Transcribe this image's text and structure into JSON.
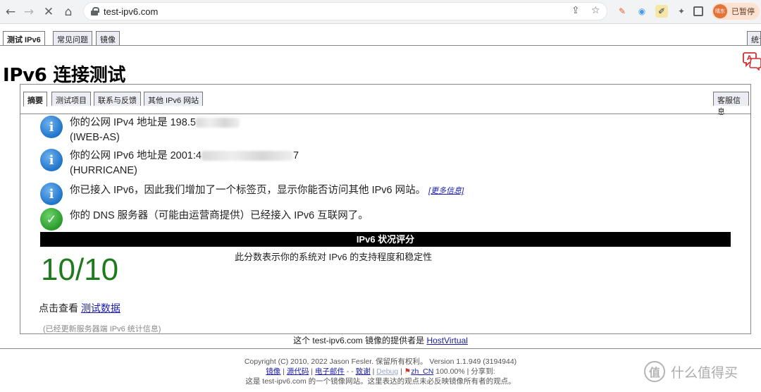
{
  "browser": {
    "url": "test-ipv6.com",
    "profile_label": "已暂停",
    "avatar_text": "晴东"
  },
  "top_tabs": [
    {
      "label": "测试 IPv6",
      "active": true
    },
    {
      "label": "常见问题",
      "active": false
    },
    {
      "label": "镜像",
      "active": false
    },
    {
      "label": "统计",
      "active": false
    }
  ],
  "page": {
    "title": "IPv6 连接测试"
  },
  "inner_tabs": [
    {
      "label": "摘要",
      "active": true
    },
    {
      "label": "测试项目",
      "active": false
    },
    {
      "label": "联系与反馈",
      "active": false
    },
    {
      "label": "其他 IPv6 网站",
      "active": false
    },
    {
      "label": "客服信息",
      "active": false
    }
  ],
  "results": {
    "ipv4_prefix": "你的公网 IPv4 地址是 198.5",
    "ipv4_isp": "(IWEB-AS)",
    "ipv6_prefix": "你的公网 IPv6 地址是 2001:4",
    "ipv6_tail": "7",
    "ipv6_isp": "(HURRICANE)",
    "ipv6_tab_msg": "你已接入 IPv6，因此我们增加了一个标签页，显示你能否访问其他 IPv6 网站。",
    "more_info": "[更多信息]",
    "dns_msg": "你的 DNS 服务器（可能由运营商提供）已经接入 IPv6 互联网了。"
  },
  "score": {
    "header": "IPv6 状况评分",
    "value": "10/10",
    "description": "此分数表示你的系统对 IPv6 的支持程度和稳定性",
    "view_prefix": "点击查看",
    "view_link": "测试数据",
    "updated_note": "(已经更新服务器端 IPv6 统计信息)"
  },
  "footer": {
    "mirror_prefix": "这个 test-ipv6.com 镜像的提供者是",
    "mirror_host": "HostVirtual",
    "copyright": "Copyright (C) 2010, 2022 Jason Fesler. 保留所有权利。 Version 1.1.949 (3194944)",
    "links": {
      "mirror": "镜像",
      "source": "源代码",
      "email": "电子邮件",
      "dash": "-",
      "thanks": "致谢",
      "debug": "Debug",
      "locale": "zh_CN",
      "percent": "100.00%",
      "share": "分享到:"
    },
    "disclaimer": "这是 test-ipv6.com 的一个镜像网站。这里表达的观点未必反映镜像所有者的观点。"
  },
  "watermark": {
    "symbol": "值",
    "text": "什么值得买"
  },
  "colors": {
    "score_green": "#1d7a1d",
    "link_blue": "#1a1aa6",
    "info_blue": "#1f73c9",
    "ok_green": "#2a9a2a"
  }
}
